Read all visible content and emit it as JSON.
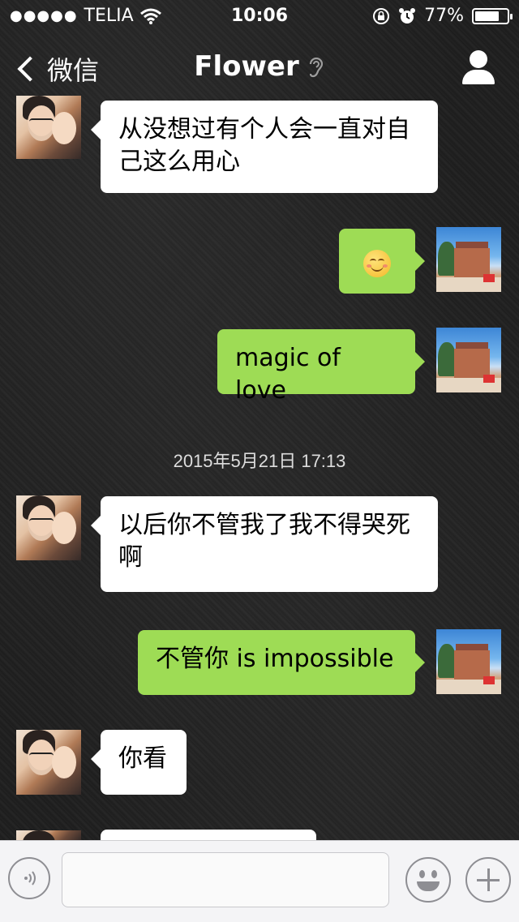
{
  "status_bar": {
    "signal": "●●●●●",
    "carrier": "TELIA",
    "wifi_icon": "wifi-icon",
    "time": "10:06",
    "battery": "77%",
    "battery_level": 0.77
  },
  "nav": {
    "back_label": "微信",
    "title": "Flower",
    "ear_icon": "ear-icon",
    "profile_icon": "profile-icon"
  },
  "messages": [
    {
      "sender": "contact",
      "text": "从没想过有个人会一直对自己这么用心"
    },
    {
      "sender": "me",
      "text": "",
      "emoji": "smiling-face"
    },
    {
      "sender": "me",
      "text": "magic of love"
    },
    {
      "sender": "contact",
      "text": "以后你不管我了我不得哭死啊"
    },
    {
      "sender": "me",
      "text": "不管你 is impossible"
    },
    {
      "sender": "contact",
      "text": "你看"
    }
  ],
  "timestamp": "2015年5月21日 17:13",
  "input_bar": {
    "voice_icon": "voice-icon",
    "text_value": "",
    "emoji_icon": "emoji-icon",
    "plus_icon": "plus-icon"
  }
}
